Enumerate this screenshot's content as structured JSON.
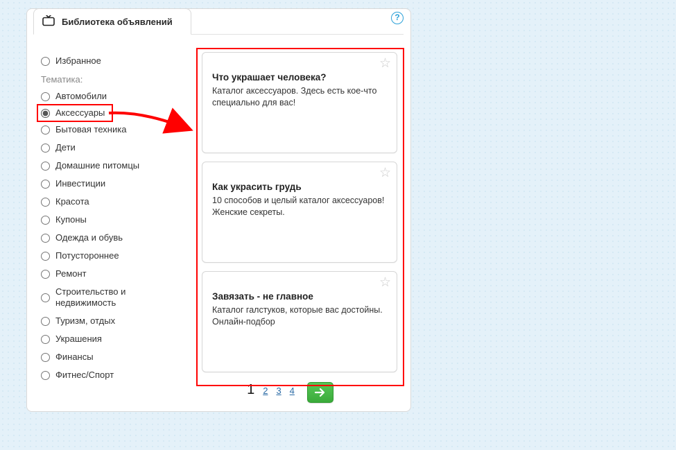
{
  "header": {
    "title": "Библиотека объявлений"
  },
  "sidebar": {
    "favorite_label": "Избранное",
    "section_label": "Тематика:",
    "items": [
      {
        "label": "Автомобили",
        "selected": false
      },
      {
        "label": "Аксессуары",
        "selected": true,
        "highlight": true
      },
      {
        "label": "Бытовая техника",
        "selected": false
      },
      {
        "label": "Дети",
        "selected": false
      },
      {
        "label": "Домашние питомцы",
        "selected": false
      },
      {
        "label": "Инвестиции",
        "selected": false
      },
      {
        "label": "Красота",
        "selected": false
      },
      {
        "label": "Купоны",
        "selected": false
      },
      {
        "label": "Одежда и обувь",
        "selected": false
      },
      {
        "label": "Потустороннее",
        "selected": false
      },
      {
        "label": "Ремонт",
        "selected": false
      },
      {
        "label": "Строительство и недвижимость",
        "selected": false
      },
      {
        "label": "Туризм, отдых",
        "selected": false
      },
      {
        "label": "Украшения",
        "selected": false
      },
      {
        "label": "Финансы",
        "selected": false
      },
      {
        "label": "Фитнес/Спорт",
        "selected": false
      }
    ]
  },
  "cards": [
    {
      "title": "Что украшает человека?",
      "desc": "Каталог аксессуаров. Здесь есть кое-что специально для вас!"
    },
    {
      "title": "Как украсить грудь",
      "desc": "10 способов и целый каталог аксессуаров! Женские секреты."
    },
    {
      "title": "Завязать - не главное",
      "desc": "Каталог галстуков, которые вас достойны. Онлайн-подбор"
    }
  ],
  "pagination": {
    "pages": [
      "1",
      "2",
      "3",
      "4"
    ],
    "current": "1"
  }
}
